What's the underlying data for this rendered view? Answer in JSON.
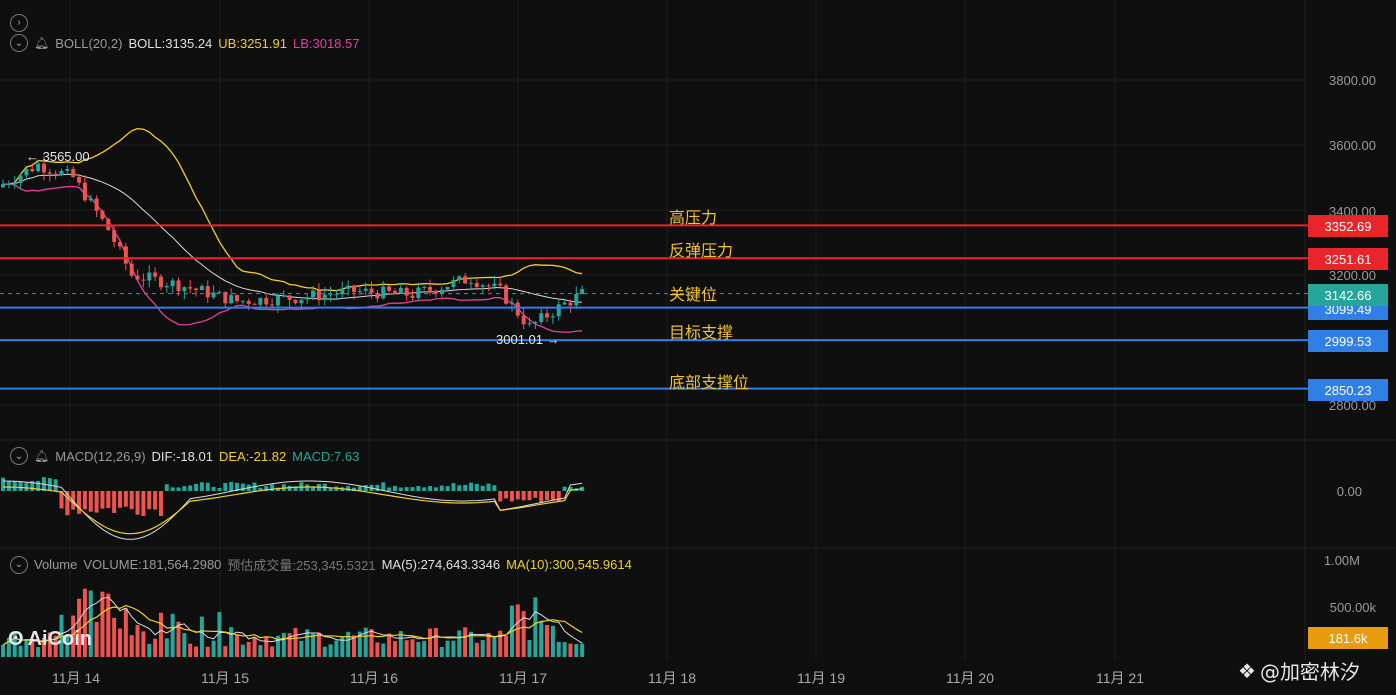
{
  "colors": {
    "background": "#0f0f10",
    "up": "#26a69a",
    "down": "#ef5350",
    "boll_mid": "#d9d9d9",
    "boll_upper": "#f1d02a",
    "boll_lower": "#e040a0",
    "red_line": "#e8252b",
    "blue_line": "#2f7fe6",
    "teal_badge": "#26a69a",
    "annotation": "#f1c232",
    "volume_badge": "#e89b0c"
  },
  "boll_header": {
    "name": "BOLL(20,2)",
    "boll": "BOLL:3135.24",
    "ub": "UB:3251.91",
    "lb": "LB:3018.57"
  },
  "macd_header": {
    "name": "MACD(12,26,9)",
    "dif": "DIF:-18.01",
    "dea": "DEA:-21.82",
    "macd": "MACD:7.63"
  },
  "volume_header": {
    "name": "Volume",
    "volume": "VOLUME:181,564.2980",
    "est": "预估成交量:253,345.5321",
    "ma5": "MA(5):274,643.3346",
    "ma10": "MA(10):300,545.9614"
  },
  "annotations": {
    "high_pressure": "高压力",
    "rebound_pressure": "反弹压力",
    "key_level": "关键位",
    "target_support": "目标支撑",
    "bottom_support": "底部支撑位"
  },
  "price_badges": {
    "high_pressure": "3352.69",
    "rebound_pressure": "3251.61",
    "current": "3142.66",
    "key_level": "3099.49",
    "target_support": "2999.53",
    "bottom_support": "2850.23"
  },
  "markers": {
    "high": "← 3565.00",
    "low": "3001.01 →"
  },
  "price_axis": [
    "3800.00",
    "3600.00",
    "3400.00",
    "3200.00",
    "2800.00"
  ],
  "macd_axis": [
    "0.00"
  ],
  "volume_axis": [
    "1.00M",
    "500.00k"
  ],
  "volume_badge": "181.6k",
  "dates": [
    "11月 14",
    "11月 15",
    "11月 16",
    "11月 17",
    "11月 18",
    "11月 19",
    "11月 20",
    "11月 21"
  ],
  "logo": "AiCoin",
  "watermark": "@加密林汐",
  "chart_data": {
    "type": "candlestick",
    "interval_note": "",
    "price_range": [
      2700,
      3880
    ],
    "levels": [
      {
        "label": "高压力",
        "price": 3352.69,
        "color": "red"
      },
      {
        "label": "反弹压力",
        "price": 3251.61,
        "color": "red"
      },
      {
        "label": "关键位",
        "price": 3099.49,
        "color": "blue"
      },
      {
        "label": "目标支撑",
        "price": 2999.53,
        "color": "blue"
      },
      {
        "label": "底部支撑位",
        "price": 2850.23,
        "color": "blue"
      }
    ],
    "current_price": 3142.66,
    "boll": {
      "mid": 3135.24,
      "upper": 3251.91,
      "lower": 3018.57
    },
    "macd": {
      "dif": -18.01,
      "dea": -21.82,
      "hist": 7.63
    },
    "volume": {
      "last": 181564.298,
      "ma5": 274643.3346,
      "ma10": 300545.9614
    }
  }
}
